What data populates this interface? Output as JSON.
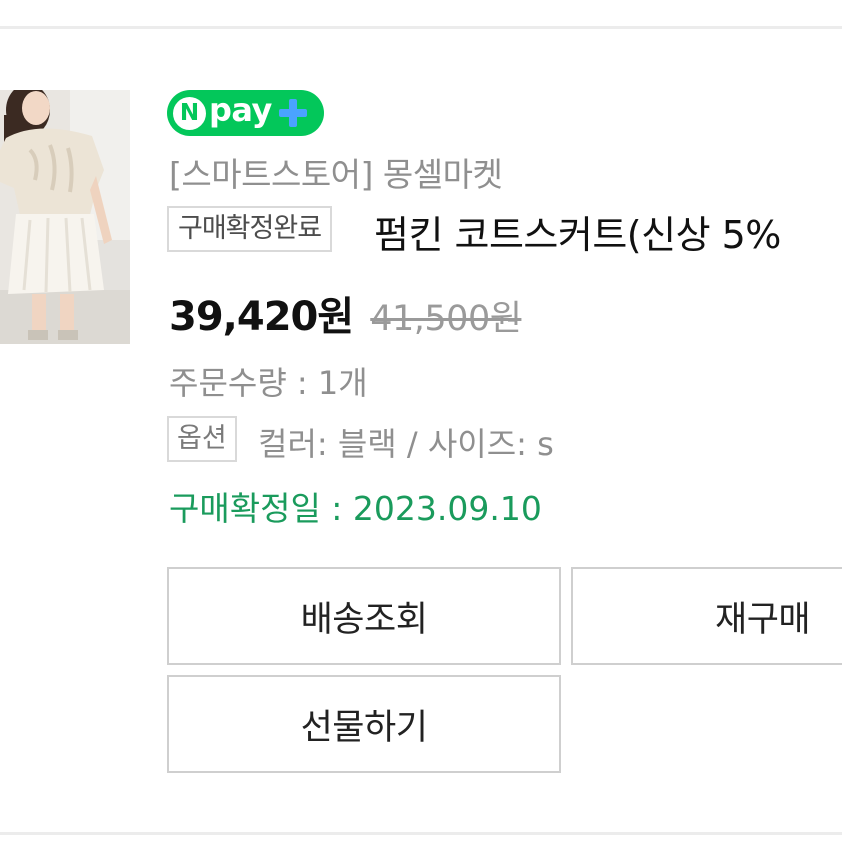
{
  "badge": {
    "npay_letter": "N",
    "npay_text": "pay",
    "plus_color": "#4aa3ff",
    "brand_color": "#03c75a"
  },
  "store": {
    "label": "[스마트스토어] 몽셀마켓"
  },
  "order": {
    "status": "구매확정완료",
    "product_title": "펌킨 코트스커트(신상 5%",
    "price": "39,420원",
    "original_price": "41,500원",
    "quantity": "주문수량 : 1개",
    "option_label": "옵션",
    "option_value": "컬러: 블랙 / 사이즈: s",
    "confirm_date": "구매확정일 : 2023.09.10",
    "confirm_color": "#1a9b5c"
  },
  "actions": {
    "track_label": "배송조회",
    "rebuy_label": "재구매",
    "gift_label": "선물하기"
  },
  "icons": {
    "thumbnail": "product-photo",
    "plus": "plus-icon"
  }
}
